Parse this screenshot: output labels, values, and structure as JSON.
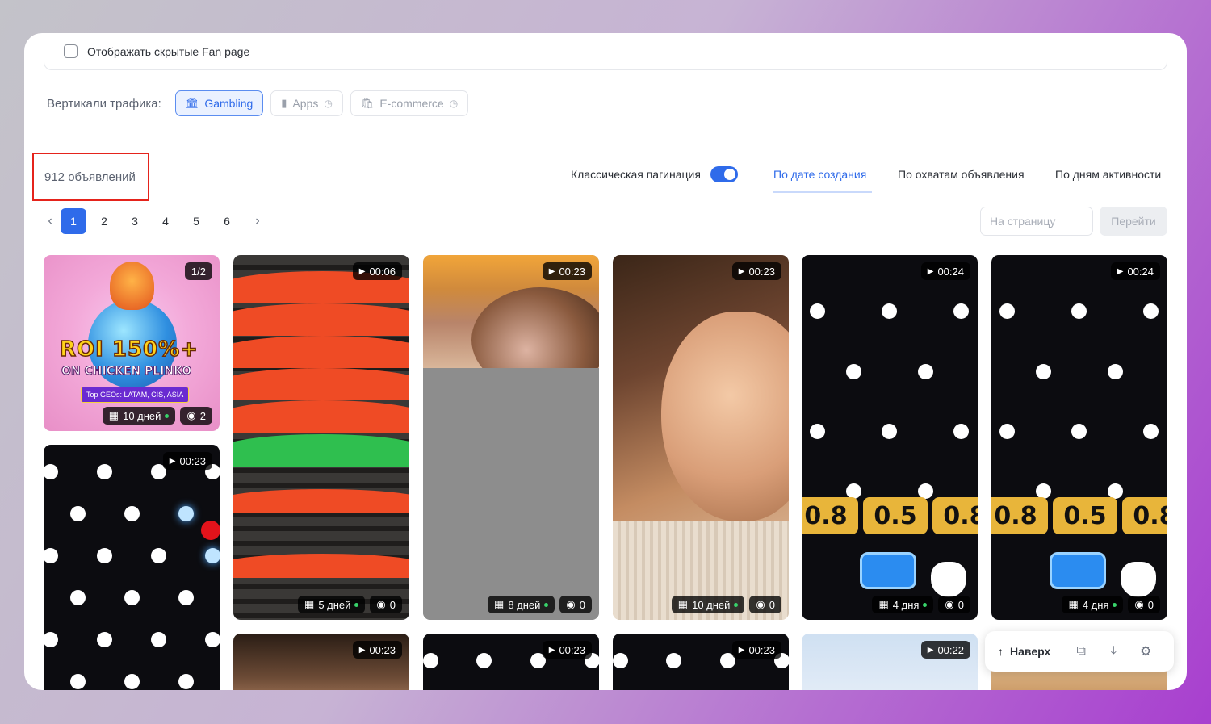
{
  "filters": {
    "show_hidden_label": "Отображать скрытые Fan page"
  },
  "verticals": {
    "caption": "Вертикали трафика:",
    "items": [
      {
        "label": "Gambling",
        "icon": "bank-icon",
        "active": true
      },
      {
        "label": "Apps",
        "icon": "phone-icon",
        "active": false
      },
      {
        "label": "E-commerce",
        "icon": "shopping-bag-icon",
        "active": false
      }
    ]
  },
  "results": {
    "count_label": "912 объявлений"
  },
  "pagination_toggle": {
    "label": "Классическая пагинация",
    "enabled": true
  },
  "sort_tabs": [
    {
      "label": "По дате создания",
      "active": true
    },
    {
      "label": "По охватам объявления",
      "active": false
    },
    {
      "label": "По дням активности",
      "active": false
    }
  ],
  "pager": {
    "pages": [
      "1",
      "2",
      "3",
      "4",
      "5",
      "6"
    ],
    "current": "1",
    "page_input_placeholder": "На страницу",
    "go_label": "Перейти"
  },
  "cards": [
    {
      "counter": "1/2",
      "days": "10 дней",
      "views": "2",
      "promo_line1": "ROI 150%+",
      "promo_line2": "ON CHICKEN PLINKO",
      "promo_line3": "Top GEOs: LATAM, CIS, ASIA"
    },
    {
      "duration": "00:06",
      "days": "5 дней",
      "views": "0"
    },
    {
      "duration": "00:23",
      "days": "8 дней",
      "views": "0"
    },
    {
      "duration": "00:23",
      "days": "10 дней",
      "views": "0"
    },
    {
      "duration": "00:24",
      "days": "4 дня",
      "views": "0",
      "bonus": [
        "0.8",
        "0.5",
        "0.8"
      ]
    },
    {
      "duration": "00:24",
      "days": "4 дня",
      "views": "0",
      "bonus": [
        "0.8",
        "0.5",
        "0.8"
      ]
    },
    {
      "duration": "00:23"
    },
    {
      "duration": "00:23"
    },
    {
      "duration": "00:23"
    },
    {
      "duration": "00:23"
    },
    {
      "duration": "00:22"
    }
  ],
  "float_bar": {
    "up_label": "Наверх",
    "icons": [
      "copy-icon",
      "download-icon",
      "settings-icon"
    ]
  },
  "colors": {
    "accent": "#2f6bea",
    "highlight_box": "#e5231b",
    "active_dot": "#38d36a"
  }
}
